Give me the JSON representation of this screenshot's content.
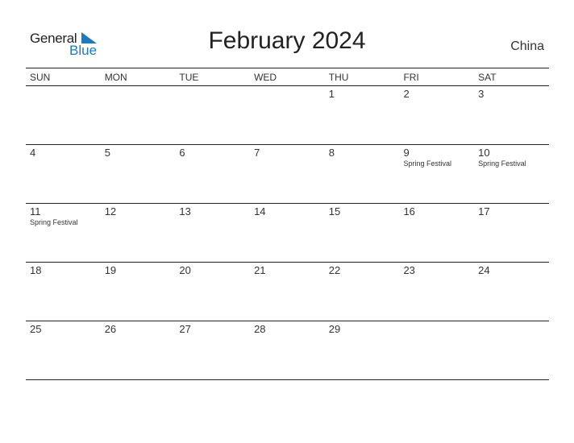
{
  "logo": {
    "line1": "General",
    "line2": "Blue"
  },
  "title": "February 2024",
  "country": "China",
  "weekdays": [
    "SUN",
    "MON",
    "TUE",
    "WED",
    "THU",
    "FRI",
    "SAT"
  ],
  "weeks": [
    [
      {
        "d": ""
      },
      {
        "d": ""
      },
      {
        "d": ""
      },
      {
        "d": ""
      },
      {
        "d": "1"
      },
      {
        "d": "2"
      },
      {
        "d": "3"
      }
    ],
    [
      {
        "d": "4"
      },
      {
        "d": "5"
      },
      {
        "d": "6"
      },
      {
        "d": "7"
      },
      {
        "d": "8"
      },
      {
        "d": "9",
        "e": "Spring Festival"
      },
      {
        "d": "10",
        "e": "Spring Festival"
      }
    ],
    [
      {
        "d": "11",
        "e": "Spring Festival"
      },
      {
        "d": "12"
      },
      {
        "d": "13"
      },
      {
        "d": "14"
      },
      {
        "d": "15"
      },
      {
        "d": "16"
      },
      {
        "d": "17"
      }
    ],
    [
      {
        "d": "18"
      },
      {
        "d": "19"
      },
      {
        "d": "20"
      },
      {
        "d": "21"
      },
      {
        "d": "22"
      },
      {
        "d": "23"
      },
      {
        "d": "24"
      }
    ],
    [
      {
        "d": "25"
      },
      {
        "d": "26"
      },
      {
        "d": "27"
      },
      {
        "d": "28"
      },
      {
        "d": "29"
      },
      {
        "d": ""
      },
      {
        "d": ""
      }
    ]
  ]
}
